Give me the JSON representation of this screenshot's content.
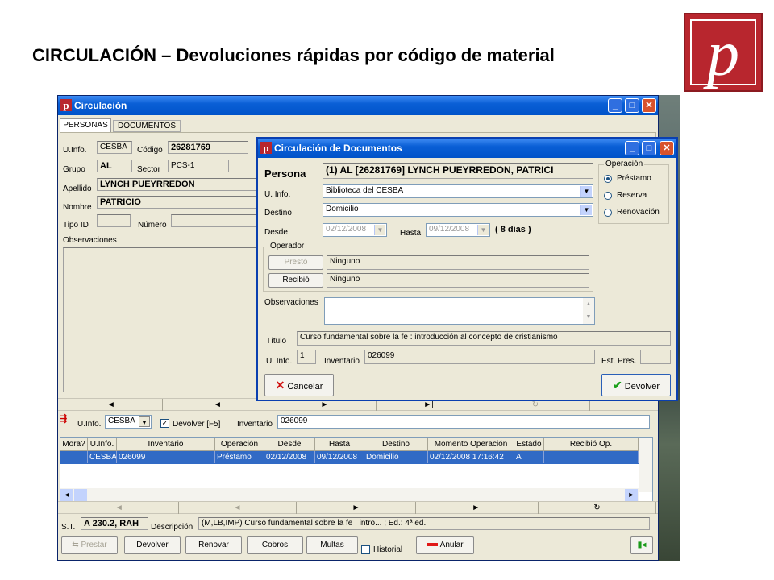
{
  "slide": {
    "title": "CIRCULACIÓN – Devoluciones rápidas por código de material",
    "logo_letter": "p"
  },
  "main_window": {
    "title": "Circulación",
    "tabs": [
      "PERSONAS",
      "DOCUMENTOS"
    ],
    "labels": {
      "uinfo": "U.Info.",
      "codigo": "Código",
      "grupo": "Grupo",
      "sector": "Sector",
      "apellido": "Apellido",
      "nombre": "Nombre",
      "tipoid": "Tipo ID",
      "numero": "Número",
      "observaciones": "Observaciones"
    },
    "values": {
      "uinfo": "CESBA",
      "codigo": "26281769",
      "grupo": "AL",
      "sector": "PCS-1",
      "apellido": "LYNCH PUEYRREDON",
      "nombre": "PATRICIO",
      "tipoid": "",
      "numero": ""
    },
    "nav_top": [
      "|◄",
      "◄",
      "►",
      "►|",
      "↻"
    ],
    "quick": {
      "uinfo_label": "U.Info.",
      "uinfo_value": "CESBA",
      "devolver_label": "Devolver [F5]",
      "inventario_label": "Inventario",
      "inventario_value": "026099"
    },
    "grid_headers": [
      "Mora?",
      "U.Info.",
      "Inventario",
      "Operación",
      "Desde",
      "Hasta",
      "Destino",
      "Momento Operación",
      "Estado",
      "Recibió Op."
    ],
    "grid_rows": [
      [
        "",
        "CESBA",
        "026099",
        "Préstamo",
        "02/12/2008",
        "09/12/2008",
        "Domicilio",
        "02/12/2008 17:16:42",
        "A",
        ""
      ]
    ],
    "nav_bottom": [
      "|◄",
      "◄",
      "►",
      "►|",
      "↻"
    ],
    "st_label": "S.T.",
    "st_value": "A 230.2, RAH",
    "descripcion_label": "Descripción",
    "descripcion_value": "(M,LB,IMP) Curso fundamental sobre la fe : intro... ; Ed.: 4ª ed.",
    "buttons": {
      "prestar": "Prestar",
      "devolver": "Devolver",
      "renovar": "Renovar",
      "cobros": "Cobros",
      "multas": "Multas",
      "historial": "Historial",
      "anular": "Anular"
    }
  },
  "dialog": {
    "title": "Circulación de Documentos",
    "persona_label": "Persona",
    "persona_value": "(1) AL [26281769] LYNCH PUEYRREDON, PATRICI",
    "uinfo_label": "U. Info.",
    "uinfo_value": "Biblioteca del CESBA",
    "destino_label": "Destino",
    "destino_value": "Domicilio",
    "desde_label": "Desde",
    "desde_value": "02/12/2008",
    "hasta_label": "Hasta",
    "hasta_value": "09/12/2008",
    "dias": "( 8 días )",
    "operacion_title": "Operación",
    "operaciones": [
      "Préstamo",
      "Reserva",
      "Renovación"
    ],
    "operador_title": "Operador",
    "presto_label": "Prestó",
    "presto_value": "Ninguno",
    "recibio_label": "Recibió",
    "recibio_value": "Ninguno",
    "observaciones_label": "Observaciones",
    "titulo_label": "Título",
    "titulo_value": "Curso fundamental sobre la fe : introducción al concepto de cristianismo",
    "uinfo2_label": "U. Info.",
    "uinfo2_value": "1",
    "inventario_label": "Inventario",
    "inventario_value": "026099",
    "estpres_label": "Est. Pres.",
    "cancelar": "Cancelar",
    "devolver": "Devolver"
  },
  "colors": {
    "titlebar": "#0a5fd6",
    "selection": "#316ac5",
    "logo": "#b8262e"
  }
}
